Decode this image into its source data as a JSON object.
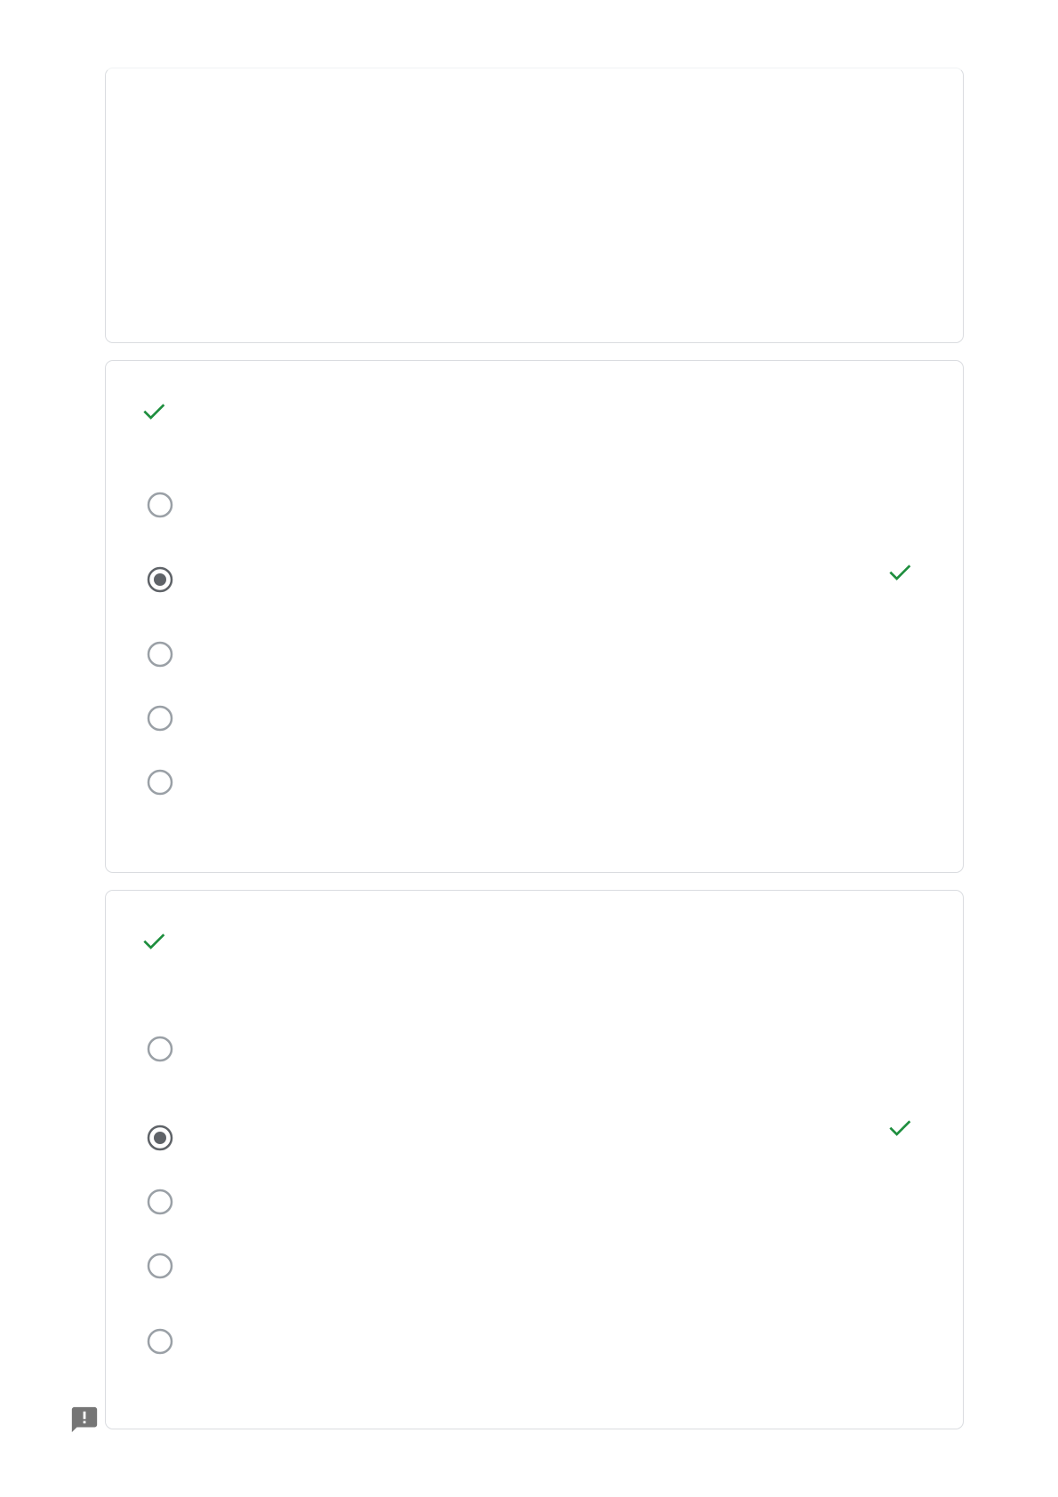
{
  "colors": {
    "correct_green": "#1e8e3e",
    "radio_unselected": "#9aa0a6",
    "radio_selected": "#5f6368",
    "card_border": "#dadce0",
    "feedback_icon": "#757575"
  },
  "icons": {
    "question_status": "check-icon",
    "answer_status": "check-icon",
    "feedback": "report-feedback-icon"
  },
  "questions": [
    {
      "status": "correct",
      "options": [
        {
          "selected": false
        },
        {
          "selected": true,
          "marked_correct": true
        },
        {
          "selected": false
        },
        {
          "selected": false
        },
        {
          "selected": false
        }
      ]
    },
    {
      "status": "correct",
      "options": [
        {
          "selected": false
        },
        {
          "selected": true,
          "marked_correct": true
        },
        {
          "selected": false
        },
        {
          "selected": false
        },
        {
          "selected": false
        }
      ]
    }
  ]
}
